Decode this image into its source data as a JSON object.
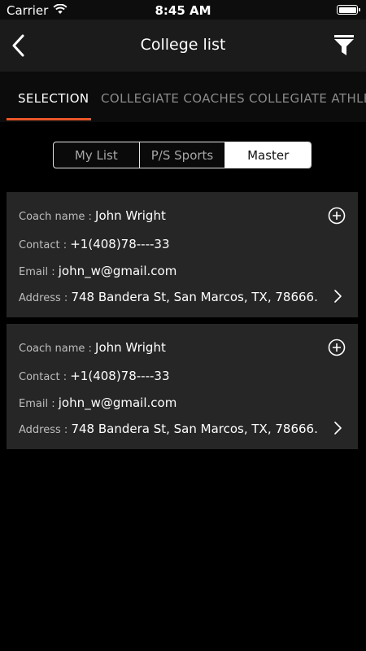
{
  "status_bar": {
    "carrier": "Carrier",
    "time": "8:45 AM"
  },
  "nav": {
    "title": "College list"
  },
  "tabs": [
    {
      "label": "SELECTION",
      "active": true
    },
    {
      "label": "COLLEGIATE COACHES",
      "active": false
    },
    {
      "label": "COLLEGIATE ATHLE",
      "active": false
    }
  ],
  "segments": [
    {
      "label": "My List",
      "selected": false
    },
    {
      "label": "P/S Sports",
      "selected": false
    },
    {
      "label": "Master",
      "selected": true
    }
  ],
  "cards": [
    {
      "coach_label": "Coach name :",
      "coach_name": "John Wright",
      "contact_label": "Contact :",
      "contact": "+1(408)78----33",
      "email_label": "Email :",
      "email": "john_w@gmail.com",
      "address_label": "Address :",
      "address": "748 Bandera St, San Marcos, TX, 78666."
    },
    {
      "coach_label": "Coach name :",
      "coach_name": "John Wright",
      "contact_label": "Contact :",
      "contact": "+1(408)78----33",
      "email_label": "Email :",
      "email": "john_w@gmail.com",
      "address_label": "Address :",
      "address": "748 Bandera St, San Marcos, TX, 78666."
    }
  ],
  "colors": {
    "accent": "#e8562a",
    "card_bg": "#262626",
    "nav_bg": "#1b1b1b"
  },
  "icons": [
    "wifi-icon",
    "battery-icon",
    "back-chevron-icon",
    "filter-icon",
    "add-circle-icon",
    "chevron-right-icon"
  ]
}
